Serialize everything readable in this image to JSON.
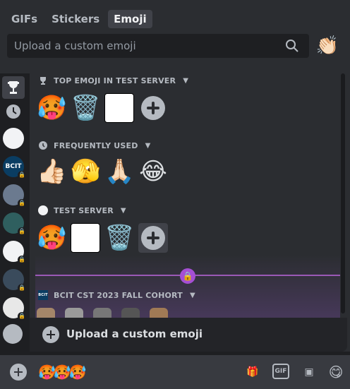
{
  "tabs": [
    {
      "label": "GIFs",
      "active": false
    },
    {
      "label": "Stickers",
      "active": false
    },
    {
      "label": "Emoji",
      "active": true
    }
  ],
  "search": {
    "placeholder": "Upload a custom emoji"
  },
  "skin_tone": "👏🏻",
  "sections": {
    "top_emoji": {
      "title": "TOP EMOJI IN TEST SERVER",
      "emojis": [
        "🥵",
        "🗑️",
        "face-drawing",
        "add-emoji"
      ]
    },
    "frequently_used": {
      "title": "FREQUENTLY USED",
      "emojis": [
        "👍🏻",
        "🫣",
        "🙏🏻",
        "😂"
      ]
    },
    "test_server": {
      "title": "TEST SERVER",
      "emojis": [
        "🥵",
        "face-drawing",
        "🗑️",
        "add-emoji"
      ]
    },
    "bcit": {
      "title": "BCIT CST 2023 FALL COHORT",
      "icon_text": "BCIT"
    }
  },
  "rail": {
    "bcit_label": "BCIT"
  },
  "upload_bar": {
    "label": "Upload a custom emoji"
  },
  "chat": {
    "message_emojis": "🥵🥵🥵",
    "gift_icon": "gift-icon",
    "gif_label": "GIF"
  },
  "colors": {
    "accent": "#a54fd4",
    "background": "#2b2d31",
    "rail": "#1e1f22"
  }
}
